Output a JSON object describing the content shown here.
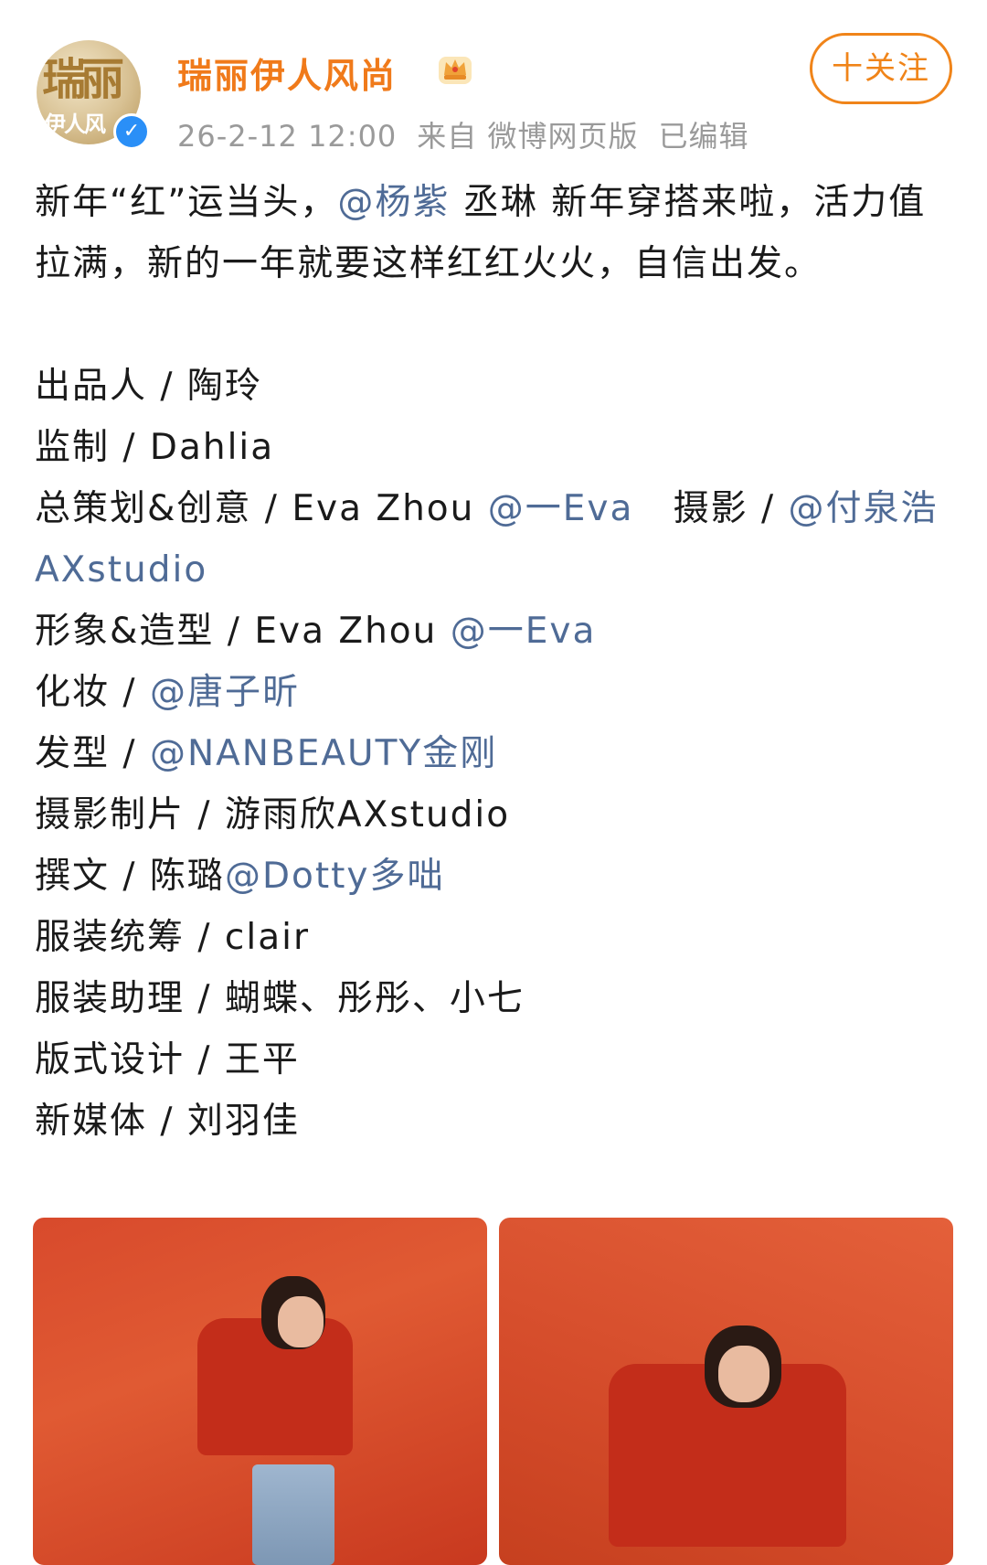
{
  "header": {
    "avatar_text": "瑞丽",
    "avatar_subtext": "伊人风",
    "account_name": "瑞丽伊人风尚",
    "crown_icon": "crown-icon",
    "timestamp": "26-2-12 12:00",
    "source": "来自 微博网页版",
    "edited": "已编辑",
    "follow_label": "十关注"
  },
  "post": {
    "intro": {
      "part1": "新年“红”运当头，",
      "mention": "@杨紫",
      "part2": " 丞琳 新年穿搭来啦，活力值拉满，新的一年就要这样红红火火，自信出发。"
    },
    "credits": [
      {
        "label": "出品人 / 陶玲"
      },
      {
        "label": "监制 / Dahlia"
      },
      {
        "label": "总策划&创意 / Eva Zhou ",
        "mention": "@一Eva",
        "label2": "   摄影 / ",
        "mention2": "@付泉浩"
      },
      {
        "mention": "AXstudio"
      },
      {
        "label": "形象&造型 / Eva Zhou ",
        "mention": "@一Eva"
      },
      {
        "label": "化妆 / ",
        "mention": "@唐子昕"
      },
      {
        "label": "发型 / ",
        "mention": "@NANBEAUTY金刚"
      },
      {
        "label": "摄影制片 / 游雨欣AXstudio"
      },
      {
        "label": "撰文 / 陈璐",
        "mention": "@Dotty多咄"
      },
      {
        "label": "服装统筹 / clair"
      },
      {
        "label": "服装助理 / 蝴蝶、彤彤、小七"
      },
      {
        "label": "版式设计 / 王平"
      },
      {
        "label": "新媒体 / 刘羽佳"
      }
    ]
  },
  "colors": {
    "brand_orange": "#f08419",
    "mention_blue": "#4f6b96",
    "meta_gray": "#9a9a9a",
    "photo_red": "#d84a2c"
  }
}
